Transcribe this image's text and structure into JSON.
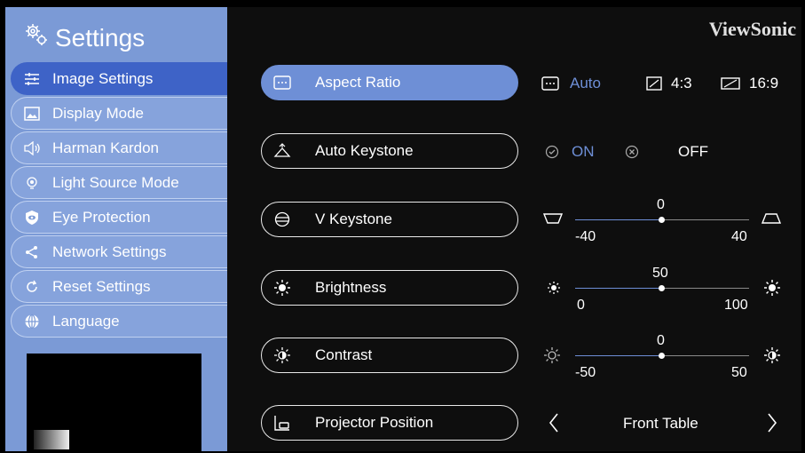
{
  "sidebar": {
    "title": "Settings",
    "items": [
      {
        "label": "Image Settings",
        "icon": "sliders-icon",
        "active": true
      },
      {
        "label": "Display Mode",
        "icon": "picture-icon"
      },
      {
        "label": "Harman Kardon",
        "icon": "speaker-icon"
      },
      {
        "label": "Light Source Mode",
        "icon": "bulb-icon"
      },
      {
        "label": "Eye Protection",
        "icon": "eye-shield-icon"
      },
      {
        "label": "Network Settings",
        "icon": "share-icon"
      },
      {
        "label": "Reset Settings",
        "icon": "reset-icon"
      },
      {
        "label": "Language",
        "icon": "globe-icon"
      }
    ]
  },
  "brand": "ViewSonic",
  "rows": {
    "aspect": {
      "label": "Aspect Ratio",
      "options": [
        "Auto",
        "4:3",
        "16:9"
      ],
      "selected": "Auto"
    },
    "keystone": {
      "label": "Auto Keystone",
      "on": "ON",
      "off": "OFF",
      "selected": "ON"
    },
    "vkeystone": {
      "label": "V Keystone",
      "value": "0",
      "min": "-40",
      "max": "40",
      "fraction": 0.5
    },
    "brightness": {
      "label": "Brightness",
      "value": "50",
      "min": "0",
      "max": "100",
      "fraction": 0.5
    },
    "contrast": {
      "label": "Contrast",
      "value": "0",
      "min": "-50",
      "max": "50",
      "fraction": 0.5
    },
    "position": {
      "label": "Projector Position",
      "value": "Front Table"
    }
  },
  "colors": {
    "accent": "#6e8fd6",
    "sidebar": "#7b9ad6",
    "active_item": "#3e63c7"
  }
}
